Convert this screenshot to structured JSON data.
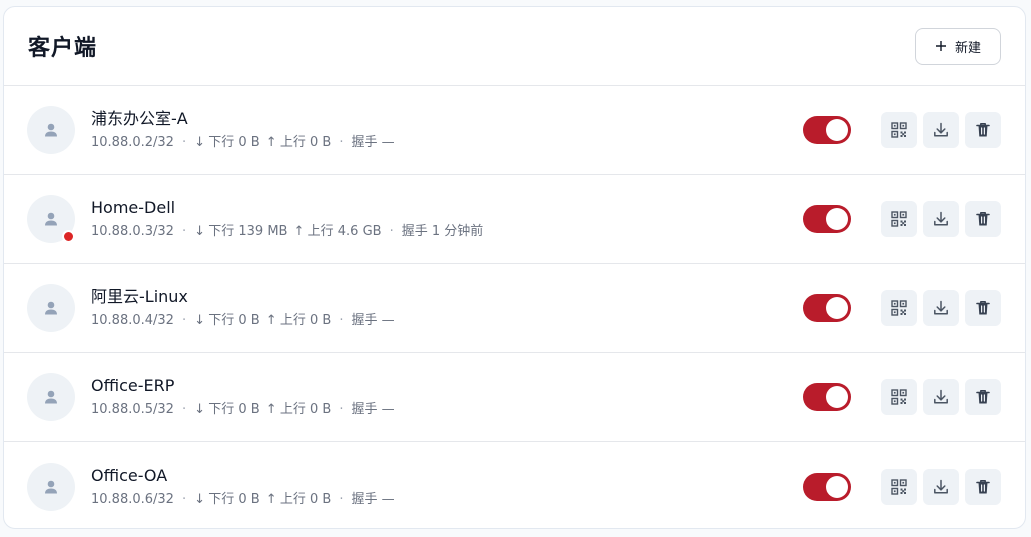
{
  "header": {
    "title": "客户端",
    "new_button_label": "新建"
  },
  "labels": {
    "down": "下行",
    "up": "上行",
    "handshake": "握手"
  },
  "colors": {
    "toggle_on": "#b91c2b",
    "status_dot": "#dc2626",
    "icon_bg": "#eef2f6"
  },
  "clients": [
    {
      "name": "浦东办公室-A",
      "ip": "10.88.0.2/32",
      "down": "0 B",
      "up": "0 B",
      "handshake": "—",
      "online": false,
      "enabled": true
    },
    {
      "name": "Home-Dell",
      "ip": "10.88.0.3/32",
      "down": "139 MB",
      "up": "4.6 GB",
      "handshake": "1 分钟前",
      "online": true,
      "enabled": true
    },
    {
      "name": "阿里云-Linux",
      "ip": "10.88.0.4/32",
      "down": "0 B",
      "up": "0 B",
      "handshake": "—",
      "online": false,
      "enabled": true
    },
    {
      "name": "Office-ERP",
      "ip": "10.88.0.5/32",
      "down": "0 B",
      "up": "0 B",
      "handshake": "—",
      "online": false,
      "enabled": true
    },
    {
      "name": "Office-OA",
      "ip": "10.88.0.6/32",
      "down": "0 B",
      "up": "0 B",
      "handshake": "—",
      "online": false,
      "enabled": true
    }
  ]
}
